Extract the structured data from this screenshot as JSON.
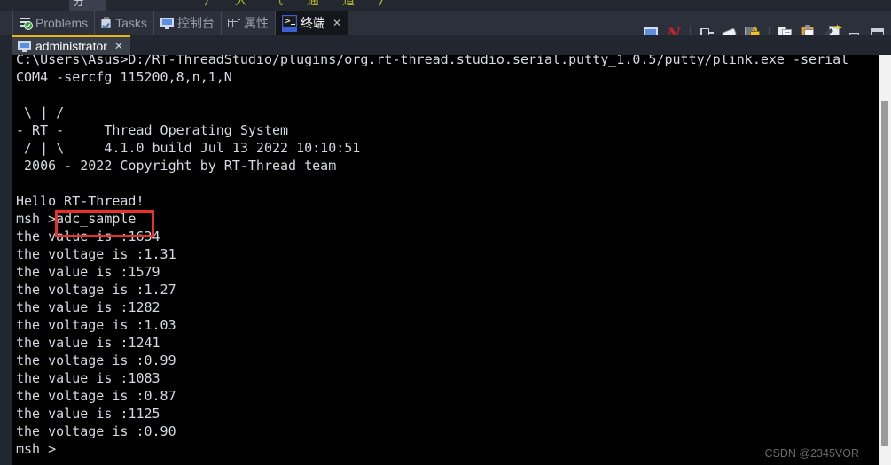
{
  "top_sliver": {
    "left_tab_label": "分",
    "code_fragment": "/ 大 气 通 道 /"
  },
  "view_tabs": [
    {
      "label": "Problems",
      "icon": "problems-icon",
      "active": false,
      "closeable": false
    },
    {
      "label": "Tasks",
      "icon": "tasks-icon",
      "active": false,
      "closeable": false
    },
    {
      "label": "控制台",
      "icon": "console-monitor-icon",
      "active": false,
      "closeable": false
    },
    {
      "label": "属性",
      "icon": "properties-grid-icon",
      "active": false,
      "closeable": false
    },
    {
      "label": "终端",
      "icon": "terminal-icon",
      "active": true,
      "closeable": true
    }
  ],
  "close_glyph": "✕",
  "toolbar": {
    "buttons": [
      {
        "name": "open-terminal-icon",
        "title": "Open a Terminal"
      },
      {
        "name": "new-terminal-connection-icon",
        "title": "N"
      },
      {
        "name": "pin-terminal-icon",
        "title": "Pin Terminal"
      },
      {
        "name": "clear-terminal-icon",
        "title": "Clear Terminal"
      },
      {
        "name": "lock-scroll-icon",
        "title": "Scroll Lock"
      },
      {
        "name": "copy-icon",
        "title": "Copy"
      },
      {
        "name": "paste-icon",
        "title": "Paste"
      },
      {
        "name": "paste-special-icon",
        "title": "Paste Special"
      },
      {
        "name": "minimize-icon",
        "title": "Minimize"
      },
      {
        "name": "maximize-icon",
        "title": "Maximize"
      }
    ]
  },
  "terminal_tab": {
    "label": "administrator"
  },
  "terminal": {
    "lines": [
      "C:\\Users\\Asus>D:/RT-ThreadStudio/plugins/org.rt-thread.studio.serial.putty_1.0.5/putty/plink.exe -serial",
      "COM4 -sercfg 115200,8,n,1,N",
      "",
      " \\ | /",
      "- RT -     Thread Operating System",
      " / | \\     4.1.0 build Jul 13 2022 10:10:51",
      " 2006 - 2022 Copyright by RT-Thread team",
      "",
      "Hello RT-Thread!",
      "msh >adc_sample",
      "the value is :1634",
      "the voltage is :1.31",
      "the value is :1579",
      "the voltage is :1.27",
      "the value is :1282",
      "the voltage is :1.03",
      "the value is :1241",
      "the voltage is :0.99",
      "the value is :1083",
      "the voltage is :0.87",
      "the value is :1125",
      "the voltage is :0.90",
      "msh >"
    ],
    "highlight": {
      "text": "adc_sample",
      "color": "#e7312c"
    },
    "prompt": "msh >",
    "command": "adc_sample"
  },
  "watermark": {
    "text": "CSDN @2345VOR"
  },
  "colors": {
    "terminal_bg": "#000000",
    "terminal_fg": "#d6dae0",
    "tab_accent": "#e8b21a",
    "active_tab_icon_bg": "#3b5fd6",
    "highlight_red": "#e7312c"
  }
}
